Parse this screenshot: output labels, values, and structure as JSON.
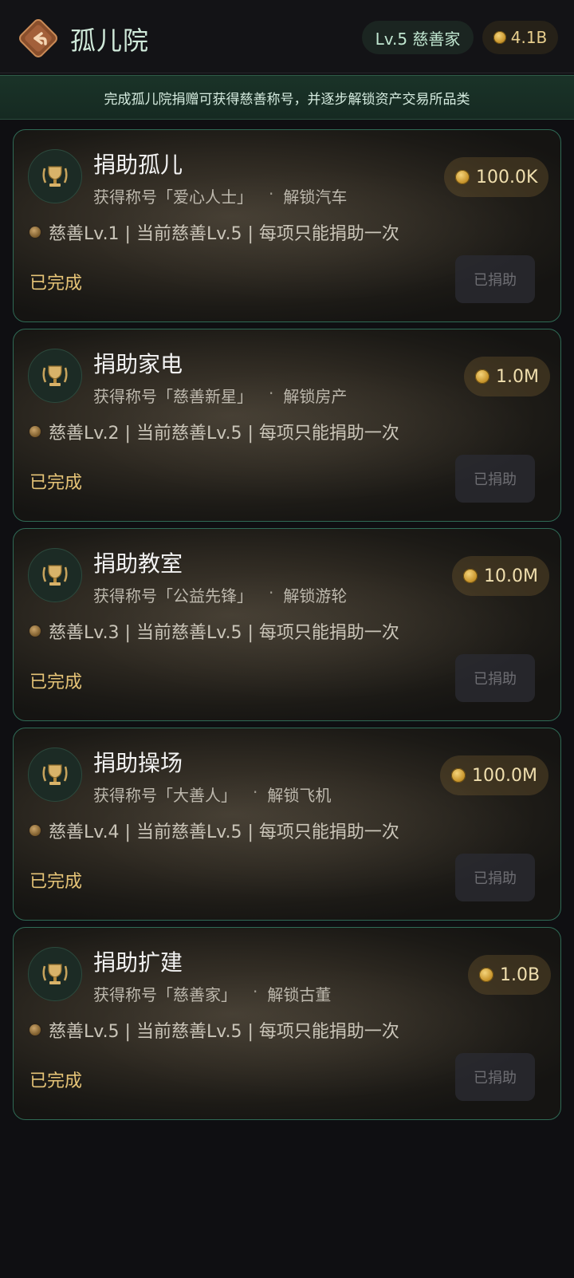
{
  "header": {
    "title": "孤儿院",
    "back_icon": "back-arrow-icon",
    "level": "Lv.5 慈善家",
    "coins": "4.1B"
  },
  "notice": "完成孤儿院捐赠可获得慈善称号，并逐步解锁资产交易所品类",
  "colors": {
    "accent_green": "#2f6a55",
    "gold": "#e6c477"
  },
  "cards": [
    {
      "title": "捐助孤儿",
      "reward": "获得称号「爱心人士」",
      "sep": "·",
      "unlock": "解锁汽车",
      "info": "慈善Lv.1 | 当前慈善Lv.5 | 每项只能捐助一次",
      "status": "已完成",
      "price": "100.0K",
      "button": "已捐助"
    },
    {
      "title": "捐助家电",
      "reward": "获得称号「慈善新星」",
      "sep": "·",
      "unlock": "解锁房产",
      "info": "慈善Lv.2 | 当前慈善Lv.5 | 每项只能捐助一次",
      "status": "已完成",
      "price": "1.0M",
      "button": "已捐助"
    },
    {
      "title": "捐助教室",
      "reward": "获得称号「公益先锋」",
      "sep": "·",
      "unlock": "解锁游轮",
      "info": "慈善Lv.3 | 当前慈善Lv.5 | 每项只能捐助一次",
      "status": "已完成",
      "price": "10.0M",
      "button": "已捐助"
    },
    {
      "title": "捐助操场",
      "reward": "获得称号「大善人」",
      "sep": "·",
      "unlock": "解锁飞机",
      "info": "慈善Lv.4 | 当前慈善Lv.5 | 每项只能捐助一次",
      "status": "已完成",
      "price": "100.0M",
      "button": "已捐助"
    },
    {
      "title": "捐助扩建",
      "reward": "获得称号「慈善家」",
      "sep": "·",
      "unlock": "解锁古董",
      "info": "慈善Lv.5 | 当前慈善Lv.5 | 每项只能捐助一次",
      "status": "已完成",
      "price": "1.0B",
      "button": "已捐助"
    }
  ]
}
